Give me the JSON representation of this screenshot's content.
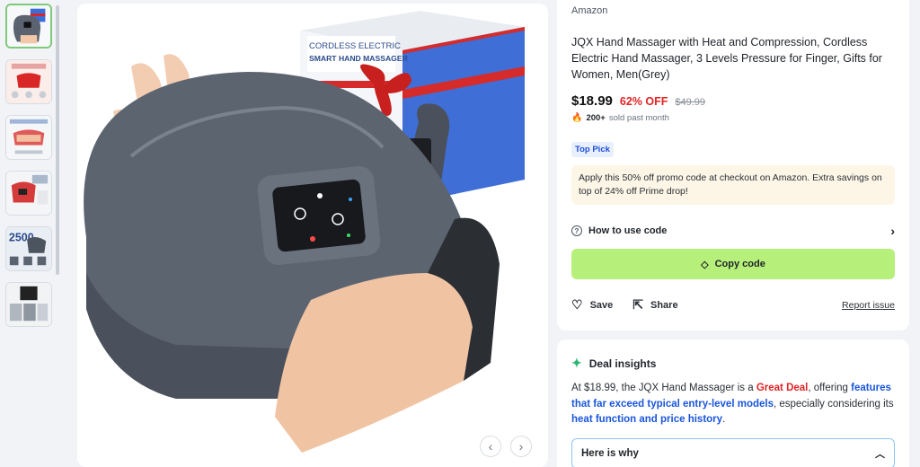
{
  "thumbnails": [
    {
      "name": "thumb-1",
      "active": true
    },
    {
      "name": "thumb-2",
      "active": false
    },
    {
      "name": "thumb-3",
      "active": false
    },
    {
      "name": "thumb-4",
      "active": false
    },
    {
      "name": "thumb-5",
      "active": false
    },
    {
      "name": "thumb-6",
      "active": false
    }
  ],
  "product_image": {
    "box_line1": "CORDLESS ELECTRIC",
    "box_line2": "SMART HAND MASSAGER",
    "thumb5_text": "2500"
  },
  "product": {
    "store": "Amazon",
    "title": "JQX Hand Massager with Heat and Compression, Cordless Electric Hand Massager, 3 Levels Pressure for Finger, Gifts for Women, Men(Grey)",
    "price": "$18.99",
    "discount": "62% OFF",
    "original_price": "$49.99",
    "sold_count": "200+",
    "sold_text": "sold past month",
    "badge": "Top Pick"
  },
  "promo": {
    "text": "Apply this 50% off promo code at checkout on Amazon. Extra savings on top of 24% off Prime drop!",
    "how_to_label": "How to use code",
    "copy_label": "Copy code"
  },
  "actions": {
    "save": "Save",
    "share": "Share",
    "report": "Report issue"
  },
  "insights": {
    "title": "Deal insights",
    "text_1": "At $18.99, the JQX Hand Massager is a ",
    "great_deal": "Great Deal",
    "text_2": ", offering ",
    "highlight_1": "features that far exceed typical entry-level models",
    "text_3": ", especially considering its ",
    "highlight_2": "heat function and price history",
    "text_4": ".",
    "why_label": "Here is why"
  },
  "colors": {
    "accent_green": "#b6f07a",
    "discount_red": "#e02424",
    "link_blue": "#1a56db",
    "badge_bg": "#e8f0fe"
  }
}
